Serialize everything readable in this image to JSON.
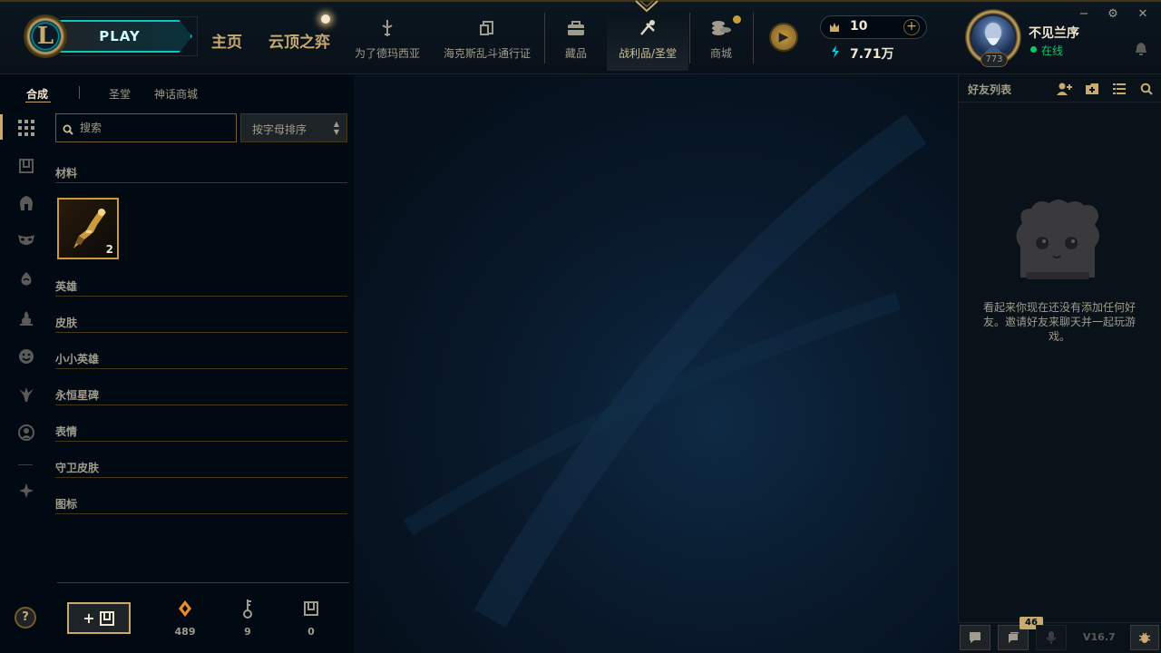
{
  "header": {
    "logo_letter": "L",
    "play_label": "PLAY",
    "mode_tabs": [
      {
        "label": "主页"
      },
      {
        "label": "云顶之弈"
      }
    ],
    "nav_items": [
      {
        "label": "为了德玛西亚",
        "icon": "sword-icon"
      },
      {
        "label": "海克斯乱斗通行证",
        "icon": "pass-icon"
      },
      {
        "label": "藏品",
        "icon": "collection-bag-icon"
      },
      {
        "label": "战利品/圣堂",
        "icon": "loot-icon",
        "active": true
      },
      {
        "label": "商城",
        "icon": "coins-stack-icon"
      }
    ],
    "clash_symbol": "▶",
    "currency": {
      "rp": "10",
      "blue_essence": "7.71万",
      "plus_label": "+"
    },
    "profile": {
      "name": "不见兰序",
      "status": "在线",
      "level": "773"
    },
    "window_controls": {
      "minimize": "−",
      "settings": "⚙",
      "close": "✕"
    }
  },
  "sidebar": {
    "help_label": "?"
  },
  "subtabs": [
    {
      "label": "合成",
      "active": true
    },
    {
      "label": "圣堂"
    },
    {
      "label": "神话商城"
    }
  ],
  "loot": {
    "search_placeholder": "搜索",
    "sort_label": "按字母排序",
    "categories": [
      {
        "label": "材料"
      },
      {
        "label": "英雄"
      },
      {
        "label": "皮肤"
      },
      {
        "label": "小小英雄"
      },
      {
        "label": "永恒星碑"
      },
      {
        "label": "表情"
      },
      {
        "label": "守卫皮肤"
      },
      {
        "label": "图标"
      }
    ],
    "items": [
      {
        "name": "key-fragment",
        "count": "2"
      }
    ],
    "craft_label": "+",
    "resources": [
      {
        "icon": "orange-essence-icon",
        "value": "489"
      },
      {
        "icon": "key-icon",
        "value": "9"
      },
      {
        "icon": "chest-icon",
        "value": "0"
      }
    ]
  },
  "friends": {
    "title": "好友列表",
    "empty_message": "看起来你现在还没有添加任何好友。邀请好友来聊天并一起玩游戏。",
    "footer": {
      "badge": "46",
      "version": "V16.7"
    }
  },
  "colors": {
    "gold": "#c8aa6e",
    "gold_dark": "#785a28",
    "bg": "#010a13",
    "text": "#a09b8c",
    "online": "#0ac86e",
    "teal": "#0ac8b9"
  }
}
